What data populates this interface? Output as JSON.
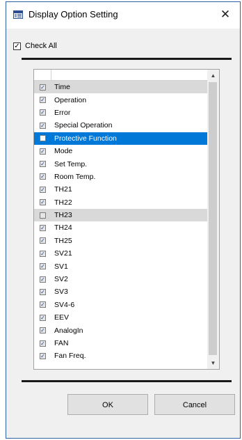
{
  "window": {
    "title": "Display Option Setting",
    "close_glyph": "✕",
    "icon": "window-app-icon"
  },
  "check_all": {
    "label": "Check All",
    "checked": true
  },
  "list": {
    "items": [
      {
        "label": "Time",
        "checked": true,
        "state": "gray"
      },
      {
        "label": "Operation",
        "checked": true,
        "state": "normal"
      },
      {
        "label": "Error",
        "checked": true,
        "state": "normal"
      },
      {
        "label": "Special Operation",
        "checked": true,
        "state": "normal"
      },
      {
        "label": "Protective Function",
        "checked": false,
        "state": "selected"
      },
      {
        "label": "Mode",
        "checked": true,
        "state": "normal"
      },
      {
        "label": "Set Temp.",
        "checked": true,
        "state": "normal"
      },
      {
        "label": "Room Temp.",
        "checked": true,
        "state": "normal"
      },
      {
        "label": "TH21",
        "checked": true,
        "state": "normal"
      },
      {
        "label": "TH22",
        "checked": true,
        "state": "normal"
      },
      {
        "label": "TH23",
        "checked": false,
        "state": "gray"
      },
      {
        "label": "TH24",
        "checked": true,
        "state": "normal"
      },
      {
        "label": "TH25",
        "checked": true,
        "state": "normal"
      },
      {
        "label": "SV21",
        "checked": true,
        "state": "normal"
      },
      {
        "label": "SV1",
        "checked": true,
        "state": "normal"
      },
      {
        "label": "SV2",
        "checked": true,
        "state": "normal"
      },
      {
        "label": "SV3",
        "checked": true,
        "state": "normal"
      },
      {
        "label": "SV4-6",
        "checked": true,
        "state": "normal"
      },
      {
        "label": "EEV",
        "checked": true,
        "state": "normal"
      },
      {
        "label": "AnalogIn",
        "checked": true,
        "state": "normal"
      },
      {
        "label": "FAN",
        "checked": true,
        "state": "normal"
      },
      {
        "label": "Fan Freq.",
        "checked": true,
        "state": "normal"
      }
    ]
  },
  "buttons": {
    "ok_label": "OK",
    "cancel_label": "Cancel"
  },
  "colors": {
    "selection": "#0078d7",
    "border": "#2b5fa8",
    "dialog_bg": "#f0f0f0"
  }
}
